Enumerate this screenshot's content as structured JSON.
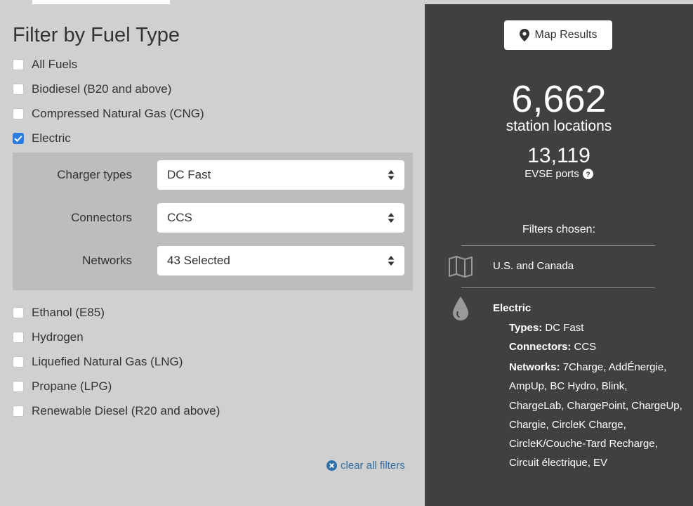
{
  "filter": {
    "title": "Filter by Fuel Type",
    "fuels": [
      {
        "label": "All Fuels",
        "checked": false
      },
      {
        "label": "Biodiesel (B20 and above)",
        "checked": false
      },
      {
        "label": "Compressed Natural Gas (CNG)",
        "checked": false
      },
      {
        "label": "Electric",
        "checked": true
      },
      {
        "label": "Ethanol (E85)",
        "checked": false
      },
      {
        "label": "Hydrogen",
        "checked": false
      },
      {
        "label": "Liquefied Natural Gas (LNG)",
        "checked": false
      },
      {
        "label": "Propane (LPG)",
        "checked": false
      },
      {
        "label": "Renewable Diesel (R20 and above)",
        "checked": false
      }
    ],
    "electric_options": {
      "charger_types_label": "Charger types",
      "charger_types_value": "DC Fast",
      "connectors_label": "Connectors",
      "connectors_value": "CCS",
      "networks_label": "Networks",
      "networks_value": "43 Selected"
    },
    "clear_all": "clear all filters"
  },
  "results": {
    "map_button": "Map Results",
    "station_count": "6,662",
    "station_label": "station locations",
    "ports_count": "13,119",
    "ports_label": "EVSE ports",
    "filters_chosen": "Filters chosen:",
    "region": "U.S. and Canada",
    "fuel": "Electric",
    "types_label": "Types:",
    "types_value": "DC Fast",
    "connectors_label": "Connectors:",
    "connectors_value": "CCS",
    "networks_label": "Networks:",
    "networks_value": "7Charge, AddÉnergie, AmpUp, BC Hydro, Blink, ChargeLab, ChargePoint, ChargeUp, Chargie, CircleK Charge, CircleK/Couche-Tard Recharge, Circuit électrique, EV"
  },
  "colors": {
    "left_bg": "#d0d0d0",
    "right_bg": "#404040",
    "checkbox_checked": "#2a7ae2",
    "link": "#2f6fa8"
  },
  "icons": [
    "check-icon",
    "updown-arrows-icon",
    "clear-x-icon",
    "map-pin-icon",
    "help-icon",
    "map-icon",
    "fuel-drop-icon"
  ]
}
